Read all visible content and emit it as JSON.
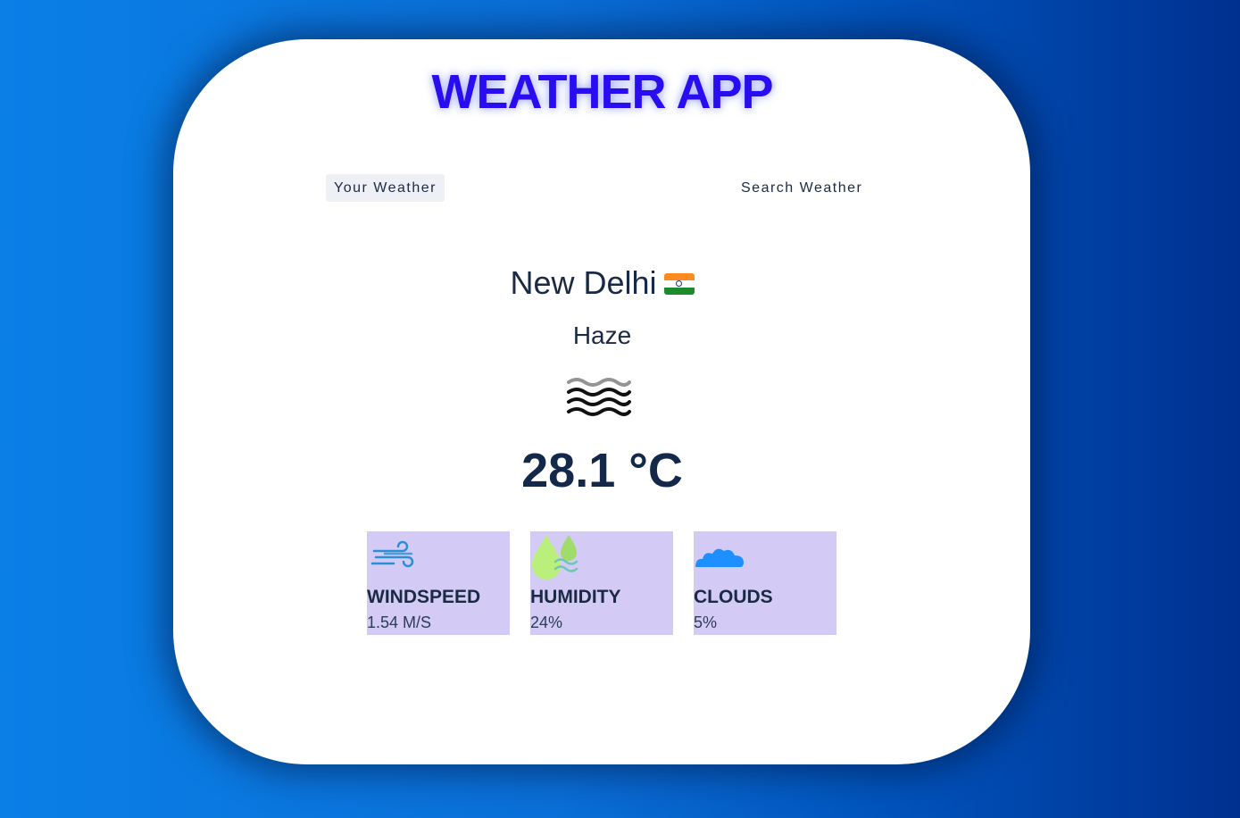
{
  "app": {
    "title": "WEATHER APP"
  },
  "tabs": [
    {
      "label": "Your Weather",
      "active": true
    },
    {
      "label": "Search Weather",
      "active": false
    }
  ],
  "weather": {
    "city": "New Delhi",
    "country_flag": "flag-india-icon",
    "condition": "Haze",
    "condition_icon": "haze-icon",
    "temperature": "28.1 °C"
  },
  "stats": [
    {
      "icon": "wind-icon",
      "label": "WINDSPEED",
      "value": "1.54 M/S"
    },
    {
      "icon": "humidity-drops-icon",
      "label": "HUMIDITY",
      "value": "24%"
    },
    {
      "icon": "cloud-icon",
      "label": "CLOUDS",
      "value": "5%"
    }
  ],
  "colors": {
    "title": "#2a0cf0",
    "card_bg": "#ffffff",
    "stat_bg": "#d3cbf5",
    "text_dark": "#1b2a44",
    "background_start": "#0a7fe6",
    "background_end": "#00308f"
  }
}
